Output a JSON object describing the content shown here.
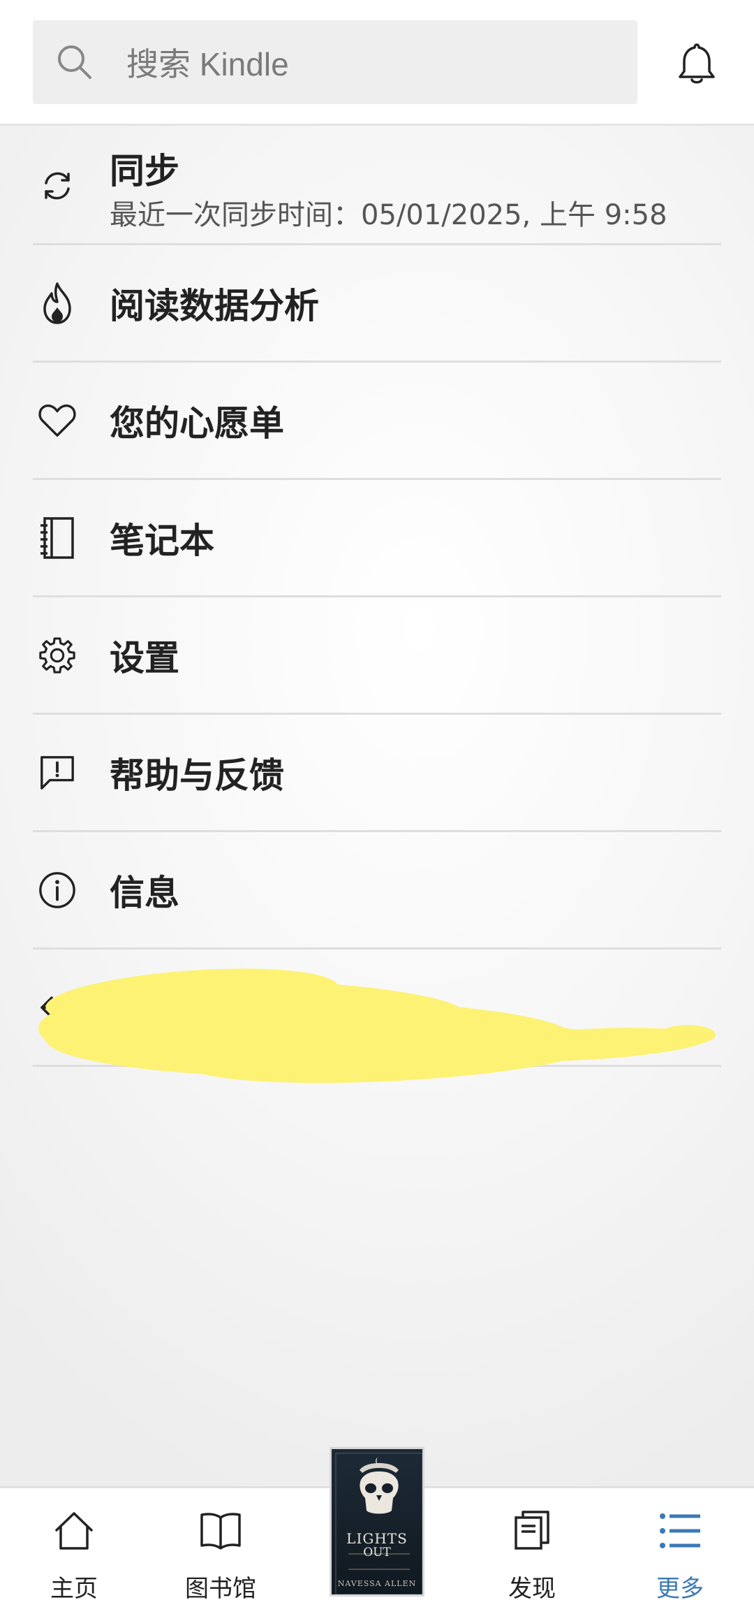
{
  "search": {
    "placeholder": "搜索 Kindle",
    "icon": "search-icon"
  },
  "header": {
    "notification_icon": "bell-icon"
  },
  "menu": {
    "sync": {
      "label": "同步",
      "sublabel": "最近一次同步时间：05/01/2025, 上午 9:58",
      "icon": "sync-icon"
    },
    "items": [
      {
        "label": "阅读数据分析",
        "icon": "flame-icon"
      },
      {
        "label": "您的心愿单",
        "icon": "heart-icon"
      },
      {
        "label": "笔记本",
        "icon": "notebook-icon"
      },
      {
        "label": "设置",
        "icon": "gear-icon"
      },
      {
        "label": "帮助与反馈",
        "icon": "feedback-icon"
      },
      {
        "label": "信息",
        "icon": "info-icon"
      }
    ],
    "redacted_item": {
      "icon": "sign-out-icon",
      "note": "redacted with yellow scribble"
    }
  },
  "bottom_nav": {
    "items": [
      {
        "label": "主页",
        "icon": "home-icon",
        "active": false
      },
      {
        "label": "图书馆",
        "icon": "book-open-icon",
        "active": false
      },
      {
        "label": "发现",
        "icon": "discover-icon",
        "active": false
      },
      {
        "label": "更多",
        "icon": "list-icon",
        "active": true
      }
    ],
    "current_book": {
      "title_line1": "LIGHTS",
      "title_line2": "OUT",
      "author": "NAVESSA ALLEN"
    }
  },
  "colors": {
    "accent": "#3b79b5",
    "scribble": "#fdf274",
    "divider": "#dedede"
  }
}
